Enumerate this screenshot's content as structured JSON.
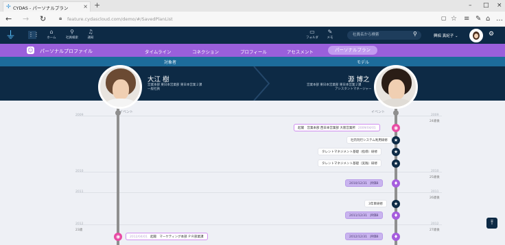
{
  "browser": {
    "tab_title": "CYDAS - パーソナルプラン",
    "url": "feature.cydascloud.com/demo/#/SavedPlanList"
  },
  "header": {
    "nav": [
      {
        "label": "ホーム",
        "icon": "home-icon",
        "glyph": "⌂"
      },
      {
        "label": "社員検索",
        "icon": "search-icon",
        "glyph": "⚲"
      },
      {
        "label": "通知",
        "icon": "bell-icon",
        "glyph": "🔔︎"
      }
    ],
    "right_nav": [
      {
        "label": "フォルダ",
        "icon": "folder-icon",
        "glyph": "▭"
      },
      {
        "label": "メモ",
        "icon": "memo-icon",
        "glyph": "✎"
      }
    ],
    "search_placeholder": "社員名から検索",
    "user_name": "興梠 真紀子"
  },
  "subnav": {
    "title": "パーソナルプロファイル",
    "tabs": [
      {
        "label": "タイムライン",
        "active": false
      },
      {
        "label": "コネクション",
        "active": false
      },
      {
        "label": "プロフィール",
        "active": false
      },
      {
        "label": "アセスメント",
        "active": false
      },
      {
        "label": "パーソナルプラン",
        "active": true
      }
    ]
  },
  "comparison": {
    "subject_label": "対象者",
    "model_label": "モデル",
    "subject": {
      "name": "大江 樹",
      "dept": "営業本部 東日本営業部 東日本営業２課",
      "role": "一般社員",
      "hair_color": "#6b4a33",
      "shirt_color": "#f4f4f4"
    },
    "model": {
      "name": "源 博之",
      "dept": "営業本部 東日本営業部 東日本営業２課",
      "role": "アシスタントマネージャー",
      "hair_color": "#2a1d16",
      "shirt_color": "#e0dcd6"
    }
  },
  "timeline": {
    "event_label_left": "イベント",
    "event_label_right": "イベント",
    "years": [
      {
        "year": "2009",
        "subject_age": "",
        "model_age": "24歳後"
      },
      {
        "year": "2010",
        "subject_age": "",
        "model_age": "25歳後"
      },
      {
        "year": "2011",
        "subject_age": "",
        "model_age": "26歳後"
      },
      {
        "year": "2012",
        "subject_age": "23歳",
        "model_age": "27歳後"
      }
    ],
    "model_events": [
      {
        "text": "起聞　営業本部 西日本営業部 大阪営業所",
        "date": "2009/04/01",
        "style": "pinkb",
        "node": "pink"
      },
      {
        "text": "社内刊行システム利用研修",
        "date": "",
        "style": "white",
        "node": "star"
      },
      {
        "text": "タレントマネジメント基礎（指導）研修",
        "date": "",
        "style": "white",
        "node": "star"
      },
      {
        "text": "タレントマネジメント基礎（実践）研修",
        "date": "",
        "style": "white",
        "node": "star"
      },
      {
        "text": "2010/12/31　評価B",
        "date": "",
        "style": "purple",
        "node": "vio"
      },
      {
        "text": "3年目研修",
        "date": "",
        "style": "white",
        "node": "star"
      },
      {
        "text": "2011/12/31　評価B",
        "date": "",
        "style": "purple",
        "node": "vio"
      },
      {
        "text": "2012/12/31　評価B",
        "date": "",
        "style": "purple",
        "node": "vio"
      }
    ],
    "subject_events": [
      {
        "text": "起聞　マーケティング本部 ＰＲ部業課",
        "date": "2012/04/01",
        "style": "pinkb",
        "node": "pink"
      }
    ]
  },
  "colors": {
    "navy": "#0d2a45",
    "purple_nav": "#9a5fdb",
    "teal_bar": "#1d6c9b",
    "hire_pink": "#e84ba5"
  }
}
